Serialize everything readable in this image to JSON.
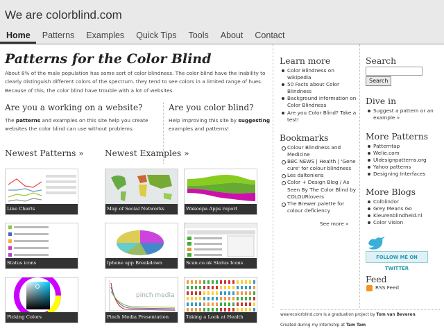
{
  "header": {
    "site_title": "We are colorblind.com",
    "nav": [
      "Home",
      "Patterns",
      "Examples",
      "Quick Tips",
      "Tools",
      "About",
      "Contact"
    ]
  },
  "main": {
    "title": "Patterns for the Color Blind",
    "intro": "About 8% of the male population has some sort of color blindness. The color blind have the inability to clearly distinguish different colors of the spectrum. they tend to see colors in a limited range of hues. Because of this, the color blind have trouble with a lot of websites.",
    "website": {
      "heading": "Are you a working on a website?",
      "text_1": "The ",
      "text_bold": "patterns",
      "text_2": " and examples on this site help you create websites the color blind can use without problems."
    },
    "colorblind": {
      "heading": "Are you color blind?",
      "text_1": "Help improving this site by ",
      "text_bold": "suggesting",
      "text_2": " examples and patterns!"
    },
    "newest_patterns_heading": "Newest Patterns »",
    "newest_examples_heading": "Newest Examples »",
    "patterns": [
      "Line Charts",
      "Status icons",
      "Picking Colors"
    ],
    "examples": [
      "Map of Social Networks",
      "Wakoopa Apps report",
      "Iphone app Breakdown",
      "Scan.co.uk Status Icons",
      "Pinch Media Presentation",
      "Taking a Look at Health"
    ]
  },
  "sidebar_left": {
    "learn_heading": "Learn more",
    "learn_items": [
      "Color Blindness on wikipedia",
      "50 Facts about Color Blindness",
      "Background information on Color Blindness",
      "Are you Color Blind? Take a test!"
    ],
    "bookmarks_heading": "Bookmarks",
    "bookmarks_items": [
      "Colour Blindness and Medicine",
      "BBC NEWS | Health | 'Gene cure' for colour blindness",
      "Les daltoniens",
      "Color + Design Blog / As Seen By The Color Blind by COLOURlovers",
      "The Brewer palette for colour deficiency"
    ],
    "see_more": "See more »"
  },
  "sidebar_right": {
    "search_heading": "Search",
    "search_button": "Search",
    "dive_heading": "Dive in",
    "dive_items": [
      "Suggest a pattern or an example »"
    ],
    "more_patterns_heading": "More Patterns",
    "more_patterns_items": [
      "Patterntap",
      "Welie.com",
      "UIdesignpatterns.org",
      "Yahoo patterns",
      "Designing Interfaces"
    ],
    "more_blogs_heading": "More Blogs",
    "more_blogs_items": [
      "Colblindor",
      "Grey Means Go",
      "Kleurenblindheid.nl",
      "Color Vision"
    ],
    "twitter_label": "FOLLOW ME ON TWITTER",
    "feed_heading": "Feed",
    "rss_label": "RSS Feed"
  },
  "footer": {
    "line1_pre": "wearecolorblind.com is a graduation project by ",
    "line1_bold": "Tom van Beveren",
    "line1_post": ".",
    "line2_pre": "Created during my internship at ",
    "line2_bold": "Tam Tam"
  },
  "colors": {
    "header_bg": "#e9e9e9",
    "caption_bg": "#333333",
    "rss": "#f7941d",
    "twitter": "#29a6c9"
  }
}
